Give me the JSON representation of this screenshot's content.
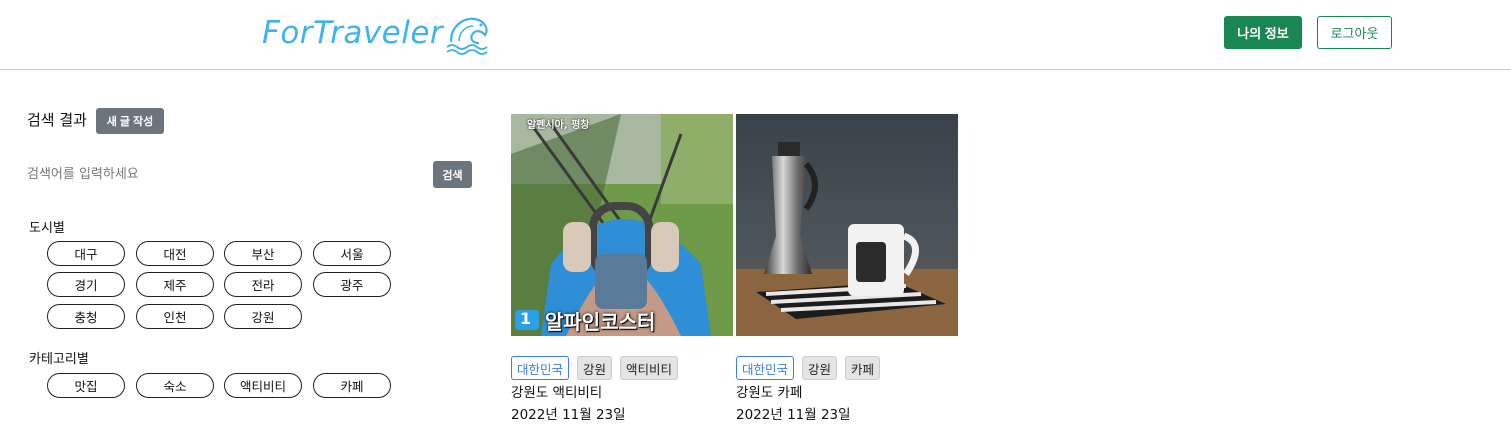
{
  "header": {
    "logo_text": "ForTraveler",
    "my_info_label": "나의 정보",
    "logout_label": "로그아웃",
    "accent_color": "#198754",
    "logo_color": "#3fb3ee"
  },
  "sidebar": {
    "search_title": "검색 결과",
    "new_post_label": "새 글 작성",
    "search_placeholder": "검색어를 입력하세요",
    "search_button_label": "검색",
    "city_section_title": "도시별",
    "cities": [
      "대구",
      "대전",
      "부산",
      "서울",
      "경기",
      "제주",
      "전라",
      "광주",
      "충청",
      "인천",
      "강원"
    ],
    "category_section_title": "카테고리별",
    "categories": [
      "맛집",
      "숙소",
      "액티비티",
      "카페"
    ]
  },
  "cards": [
    {
      "image_caption_top": "알펜시아, 평창",
      "image_caption_number": "1",
      "image_caption_main": "알파인코스터",
      "tags": [
        "대한민국",
        "강원",
        "액티비티"
      ],
      "title": "강원도 액티비티",
      "date": "2022년 11월 23일"
    },
    {
      "image_caption_top": "",
      "image_caption_number": "",
      "image_caption_main": "",
      "tags": [
        "대한민국",
        "강원",
        "카페"
      ],
      "title": "강원도 카페",
      "date": "2022년 11월 23일"
    }
  ]
}
